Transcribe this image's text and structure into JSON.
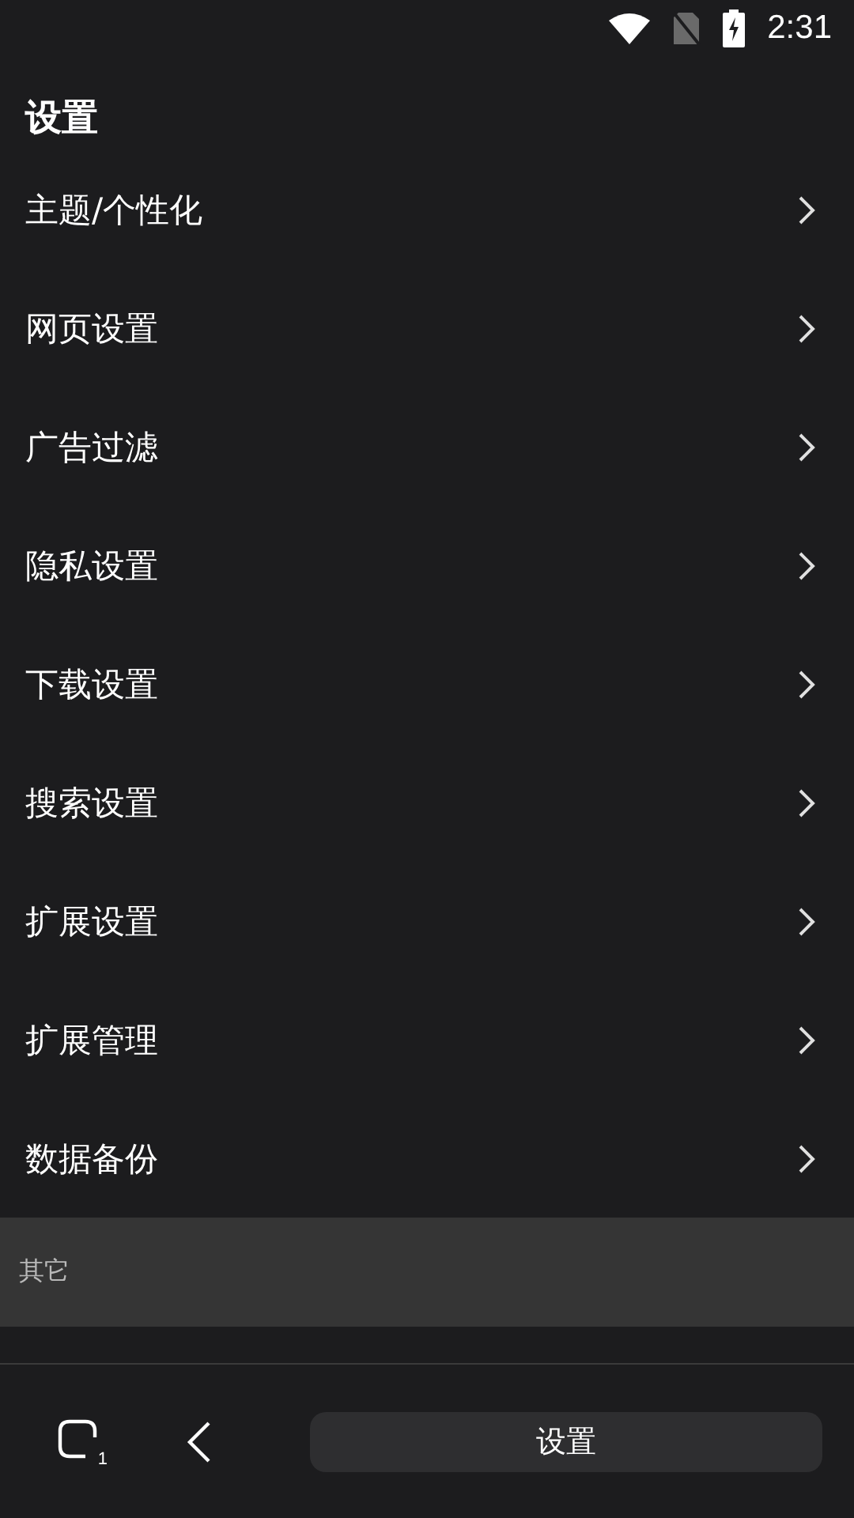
{
  "status_bar": {
    "time": "2:31"
  },
  "title": "设置",
  "items": [
    {
      "label": "主题/个性化"
    },
    {
      "label": "网页设置"
    },
    {
      "label": "广告过滤"
    },
    {
      "label": "隐私设置"
    },
    {
      "label": "下载设置"
    },
    {
      "label": "搜索设置"
    },
    {
      "label": "扩展设置"
    },
    {
      "label": "扩展管理"
    },
    {
      "label": "数据备份"
    }
  ],
  "section_header": "其它",
  "bottom_bar": {
    "tab_count": "1",
    "address": "设置"
  }
}
